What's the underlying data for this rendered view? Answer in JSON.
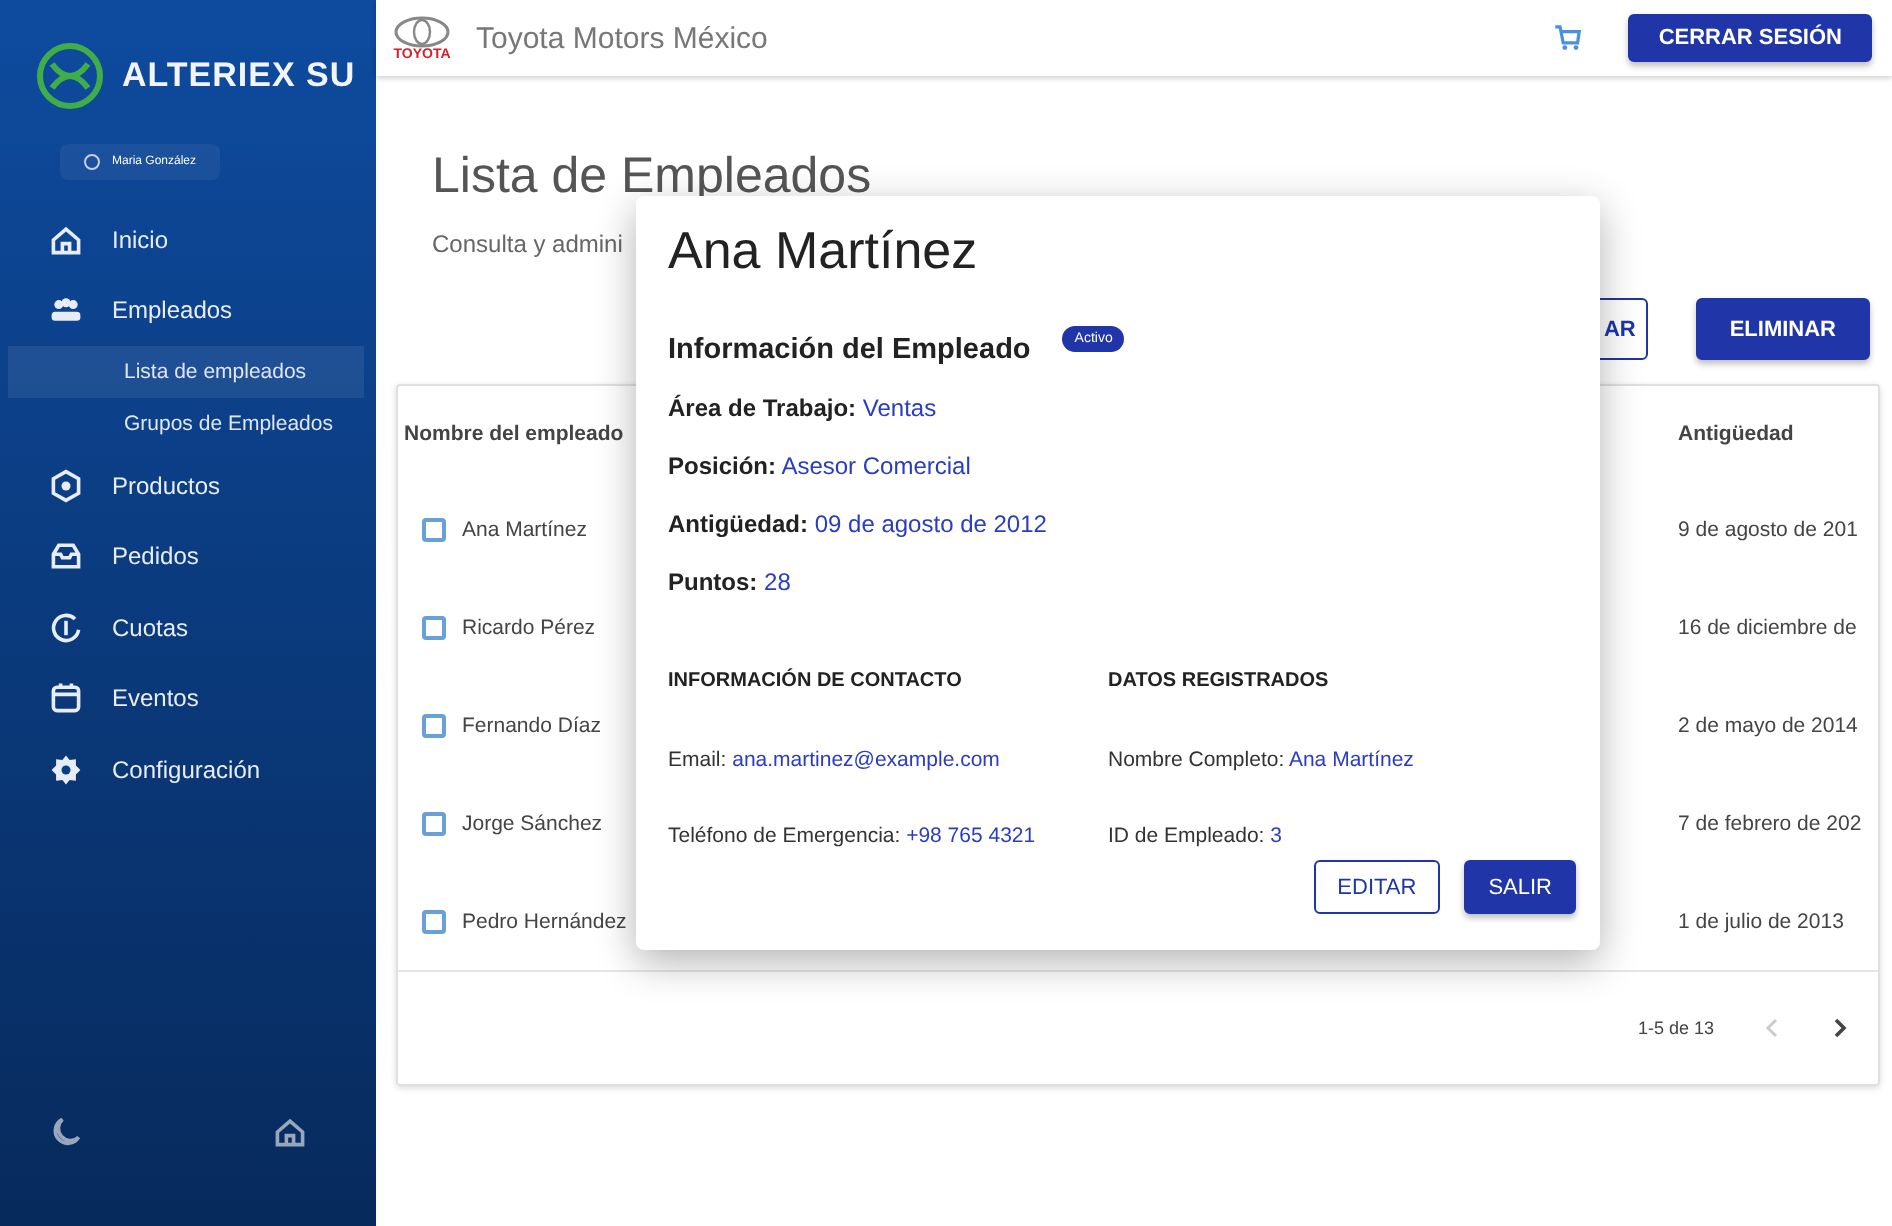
{
  "sidebar": {
    "logo": "ALTERIEX SU",
    "user": "Maria González",
    "items": [
      {
        "label": "Inicio"
      },
      {
        "label": "Empleados",
        "children": [
          {
            "label": "Lista de empleados",
            "selected": true
          },
          {
            "label": "Grupos de Empleados",
            "selected": false
          }
        ]
      },
      {
        "label": "Productos"
      },
      {
        "label": "Pedidos"
      },
      {
        "label": "Cuotas"
      },
      {
        "label": "Eventos"
      },
      {
        "label": "Configuración"
      }
    ]
  },
  "header": {
    "brand": "TOYOTA",
    "company": "Toyota Motors México",
    "logout": "CERRAR SESIÓN"
  },
  "page": {
    "title": "Lista de Empleados",
    "subtitle": "Consulta y admini",
    "buttons": [
      {
        "label": "AR",
        "kind": "outlined"
      },
      {
        "label": "ELIMINAR",
        "kind": "filled"
      }
    ]
  },
  "table": {
    "columns": [
      "Nombre del empleado",
      "Antigüedad"
    ],
    "rows": [
      {
        "name": "Ana Martínez",
        "seniority": "9 de agosto de 201",
        "checked": false
      },
      {
        "name": "Ricardo Pérez",
        "seniority": "16 de diciembre de",
        "checked": false
      },
      {
        "name": "Fernando Díaz",
        "seniority": "2 de mayo de 2014",
        "checked": false
      },
      {
        "name": "Jorge Sánchez",
        "seniority": "7 de febrero de 202",
        "checked": false
      },
      {
        "name": "Pedro Hernández",
        "seniority": "1 de julio de 2013",
        "checked": false
      }
    ],
    "pagination": "1-5 de 13"
  },
  "modal": {
    "name": "Ana Martínez",
    "section_title": "Información del Empleado",
    "status": "Activo",
    "fields": [
      {
        "label": "Área de Trabajo:",
        "value": "Ventas"
      },
      {
        "label": "Posición:",
        "value": "Asesor Comercial"
      },
      {
        "label": "Antigüedad:",
        "value": "09 de agosto de 2012"
      },
      {
        "label": "Puntos:",
        "value": "28"
      }
    ],
    "contact": {
      "title": "INFORMACIÓN DE CONTACTO",
      "items": [
        {
          "label": "Email:",
          "value": "ana.martinez@example.com"
        },
        {
          "label": "Teléfono de Emergencia:",
          "value": "+98 765 4321"
        }
      ]
    },
    "registered": {
      "title": "DATOS REGISTRADOS",
      "items": [
        {
          "label": "Nombre Completo: ",
          "value": "Ana Martínez"
        },
        {
          "label": "ID de Empleado:",
          "value": "3"
        }
      ]
    },
    "buttons": [
      {
        "label": "EDITAR",
        "kind": "outlined"
      },
      {
        "label": "SALIR",
        "kind": "filled"
      }
    ]
  }
}
